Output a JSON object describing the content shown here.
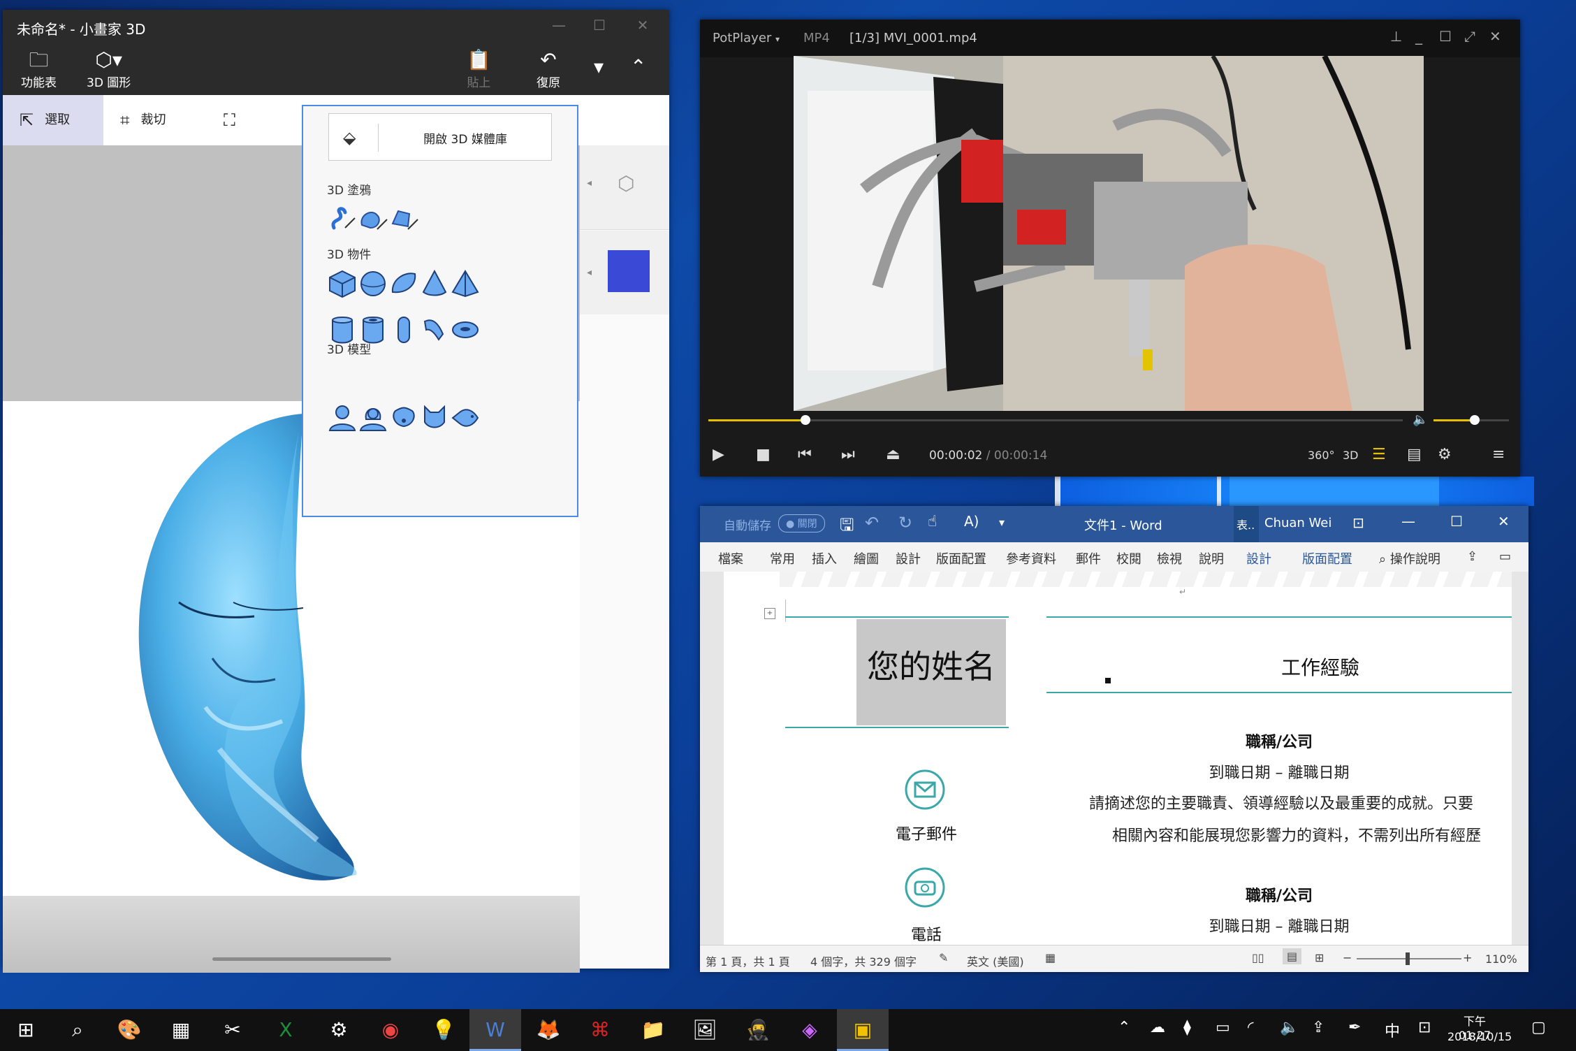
{
  "paint": {
    "title": "未命名* - 小畫家 3D",
    "ribbon": {
      "menu_label": "功能表",
      "shapes_label": "3D 圖形",
      "paste_label": "貼上",
      "undo_label": "復原"
    },
    "toolbar": {
      "select_label": "選取",
      "crop_label": "裁切"
    },
    "popup": {
      "library_label": "開啟 3D 媒體庫",
      "doodle_title": "3D 塗鴉",
      "objects_title": "3D 物件",
      "models_title": "3D 模型"
    },
    "swatch_color": "#3b4ad6"
  },
  "potplayer": {
    "app_label": "PotPlayer",
    "format": "MP4",
    "file": "[1/3] MVI_0001.mp4",
    "current_time": "00:00:02",
    "separator": "/",
    "total_time": "00:00:14",
    "progress": 0.14,
    "volume": 0.55,
    "accent": "#e6c000",
    "btn_360": "360°",
    "btn_3d": "3D"
  },
  "word": {
    "autosave_label": "自動儲存",
    "autosave_state": "關閉",
    "doc_title": "文件1 - Word",
    "table_hint": "表..",
    "user": "Chuan Wei",
    "tabs": [
      "檔案",
      "常用",
      "插入",
      "繪圖",
      "設計",
      "版面配置",
      "參考資料",
      "郵件",
      "校閱",
      "檢視",
      "說明"
    ],
    "context_tabs": [
      "設計",
      "版面配置"
    ],
    "tell_me": "操作說明",
    "doc": {
      "name": "您的姓名",
      "email_label": "電子郵件",
      "phone_label": "電話",
      "section_title": "工作經驗",
      "job_title": "職稱/公司",
      "job_dates": "到職日期 – 離職日期",
      "job_desc_1": "請摘述您的主要職責、領導經驗以及最重要的成就。只要",
      "job_desc_2": "相關內容和能展現您影響力的資料，不需列出所有經歷",
      "job_title_2": "職稱/公司",
      "job_dates_2": "到職日期 – 離職日期"
    },
    "status": {
      "page": "第 1 頁，共 1 頁",
      "words": "4 個字，共 329 個字",
      "language": "英文 (美國)",
      "zoom": "110%"
    },
    "brand_color": "#2b579a"
  },
  "taskbar": {
    "ime": "中",
    "time": "下午 01:27",
    "date": "2018/10/15"
  }
}
